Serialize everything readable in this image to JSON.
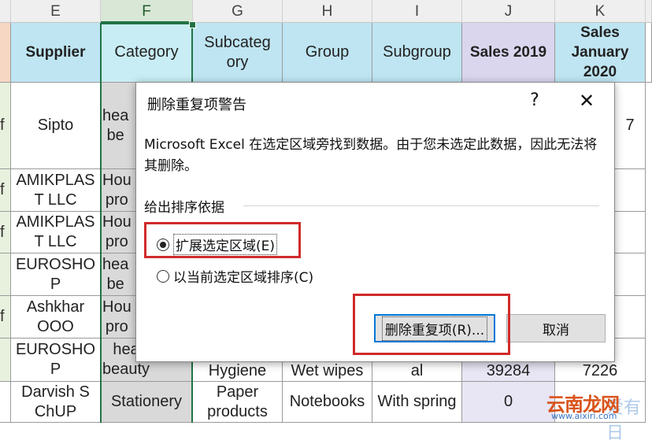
{
  "columns": [
    "E",
    "F",
    "G",
    "H",
    "I",
    "J",
    "K"
  ],
  "header": {
    "supplier": "Supplier",
    "category": "Category",
    "subcategory": "Subcateg\nory",
    "group": "Group",
    "subgroup": "Subgroup",
    "sales2019": "Sales 2019",
    "salesjan": "Sales\nJanuary\n2020"
  },
  "rows": [
    {
      "left": "f",
      "supplier": "Sipto",
      "category": "hea\nbe",
      "salesjan": "7"
    },
    {
      "left": "f",
      "supplier": "AMIKPLAS\nT LLC",
      "category": "Hou\npro"
    },
    {
      "left": "f",
      "supplier": "AMIKPLAS\nT LLC",
      "category": "Hou\npro"
    },
    {
      "left": "",
      "supplier": "EUROSHO\nP",
      "category": "hea\nbe"
    },
    {
      "left": "f",
      "supplier": "Ashkhar\nOOO",
      "category": "Hou\npro"
    },
    {
      "left": "",
      "supplier": "EUROSHO\nP",
      "category": "hea\nbeauty",
      "subcategory": "Hygiene",
      "group": "Wet wipes",
      "subgroup": "al",
      "sales2019": "39284",
      "salesjan": "7226"
    },
    {
      "left": "",
      "supplier": "Darvish S\nChUP",
      "category": "Stationery",
      "subcategory": "Paper\nproducts",
      "group": "Notebooks",
      "subgroup": "With spring",
      "sales2019": "0",
      "salesjan": ""
    }
  ],
  "dialog": {
    "title": "删除重复项警告",
    "help": "?",
    "close": "✕",
    "message": "Microsoft Excel 在选定区域旁找到数据。由于您未选定此数据，因此无法将其删除。",
    "group_label": "给出排序依据",
    "option_expand": "扩展选定区域(E)",
    "option_current": "以当前选定区域排序(C)",
    "remove_button": "删除重复项(R)...",
    "cancel_button": "取消"
  },
  "watermark": {
    "brand": "云南龙网",
    "url": "www.aixiri.com",
    "faint": "爱有日"
  },
  "colors": {
    "header_fill": "#bfe5f2",
    "sales_fill": "#d9d6ee",
    "highlight_red": "#d12a2a",
    "selection_green": "#217346",
    "primary_blue": "#0078d7"
  }
}
